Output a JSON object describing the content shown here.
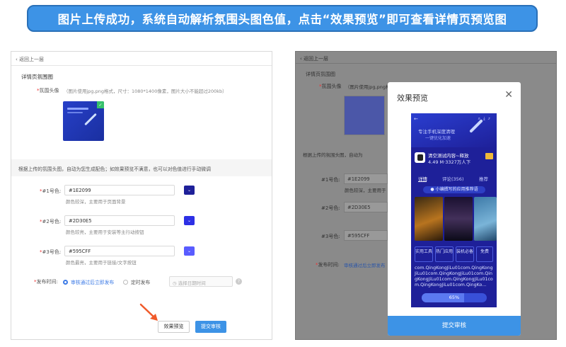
{
  "banner": "图片上传成功，系统自动解析氛围头图色值，点击“效果预览”即可查看详情页预览图",
  "back_label": "返回上一层",
  "section_title": "详情页氛围图",
  "header_image": {
    "label": "氛围头像",
    "hint": "（图片使用jpg,png格式，尺寸：1080*1400像素，图片大小不能超过200kb）"
  },
  "tip": "根据上传的氛围头图，自动为您生成配色；如效果预览不满意，也可以对色值进行手动微调",
  "colors": [
    {
      "label": "#1号色:",
      "value": "#1E2099",
      "hint": "颜色较深，主要用于页面背景",
      "swatch": "#1E2099"
    },
    {
      "label": "#2号色:",
      "value": "#2D30E5",
      "hint": "颜色较亮，主要用于安装等主行动按钮",
      "swatch": "#2D30E5"
    },
    {
      "label": "#3号色:",
      "value": "#595CFF",
      "hint": "颜色最亮，主要用于链接/文字按钮",
      "swatch": "#595CFF"
    }
  ],
  "publish": {
    "label": "发布时间:",
    "option_immediate": "审核通过后立即发布",
    "option_scheduled": "定时发布",
    "date_placeholder": "选择日期时间"
  },
  "buttons": {
    "preview": "效果预览",
    "submit": "提交审核"
  },
  "right": {
    "section_title": "详情页氛围图",
    "header_label": "氛围头像",
    "header_hint": "（图片使用jpg,png格式",
    "tip": "根据上传的氛围头图，自动为",
    "color_labels": [
      "#1号色:",
      "#2号色:",
      "#3号色:"
    ],
    "color_values": [
      "#1E2099",
      "#2D30E5",
      "#595CFF"
    ],
    "color_hint": "颜色较深，主要用于",
    "publish_label": "发布时间:",
    "publish_option": "审核通过后立即发布"
  },
  "modal": {
    "title": "效果预览",
    "submit": "提交审核",
    "phone": {
      "headline": "专注手机深度清理",
      "subline": "一键优化加速",
      "app_name": "清空测试内容~释放",
      "app_meta": "4.49 M·3327万人下",
      "tabs": [
        "详情",
        "评论(356)",
        "推荐"
      ],
      "recommend": "小编撰写的应用推荐语",
      "chips": [
        "实用工具",
        "热门应用",
        "装机必备",
        "免费"
      ],
      "package": "com.QingKongJiLu01com.QingKongJiLu01com.QingKongJiLu01com.QingKongJiLu01com.QingKongJiLu01com.QingKongJiLu01com.QingKo...",
      "progress_label": "65%",
      "progress": 0.65
    }
  }
}
